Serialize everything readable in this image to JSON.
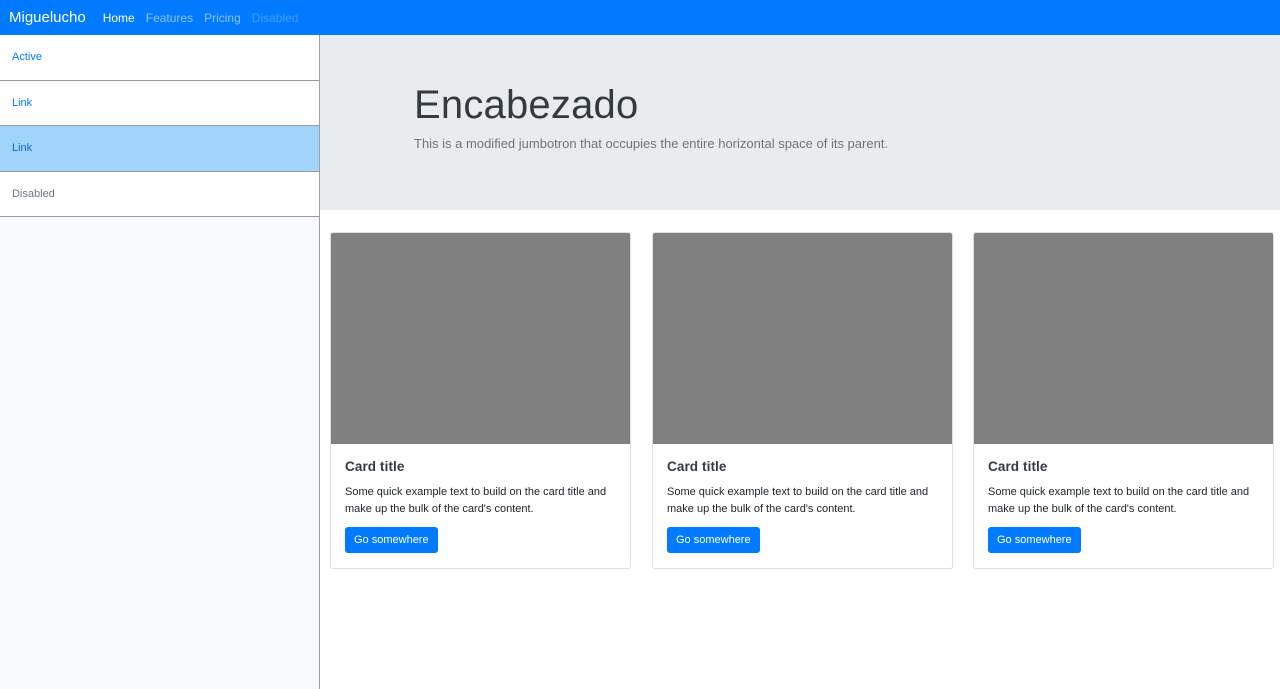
{
  "navbar": {
    "brand": "Miguelucho",
    "links": [
      {
        "label": "Home"
      },
      {
        "label": "Features"
      },
      {
        "label": "Pricing"
      },
      {
        "label": "Disabled"
      }
    ]
  },
  "sidebar": {
    "items": [
      {
        "label": "Active"
      },
      {
        "label": "Link"
      },
      {
        "label": "Link"
      },
      {
        "label": "Disabled"
      }
    ]
  },
  "jumbotron": {
    "title": "Encabezado",
    "lead": "This is a modified jumbotron that occupies the entire horizontal space of its parent."
  },
  "cards": [
    {
      "title": "Card title",
      "text": "Some quick example text to build on the card title and make up the bulk of the card's content.",
      "button": "Go somewhere"
    },
    {
      "title": "Card title",
      "text": "Some quick example text to build on the card title and make up the bulk of the card's content.",
      "button": "Go somewhere"
    },
    {
      "title": "Card title",
      "text": "Some quick example text to build on the card title and make up the bulk of the card's content.",
      "button": "Go somewhere"
    }
  ],
  "colors": {
    "primary": "#007bff",
    "jumbotron_bg": "#e9ecef",
    "highlight_bg": "#9fd4fb",
    "card_image": "#808080"
  }
}
